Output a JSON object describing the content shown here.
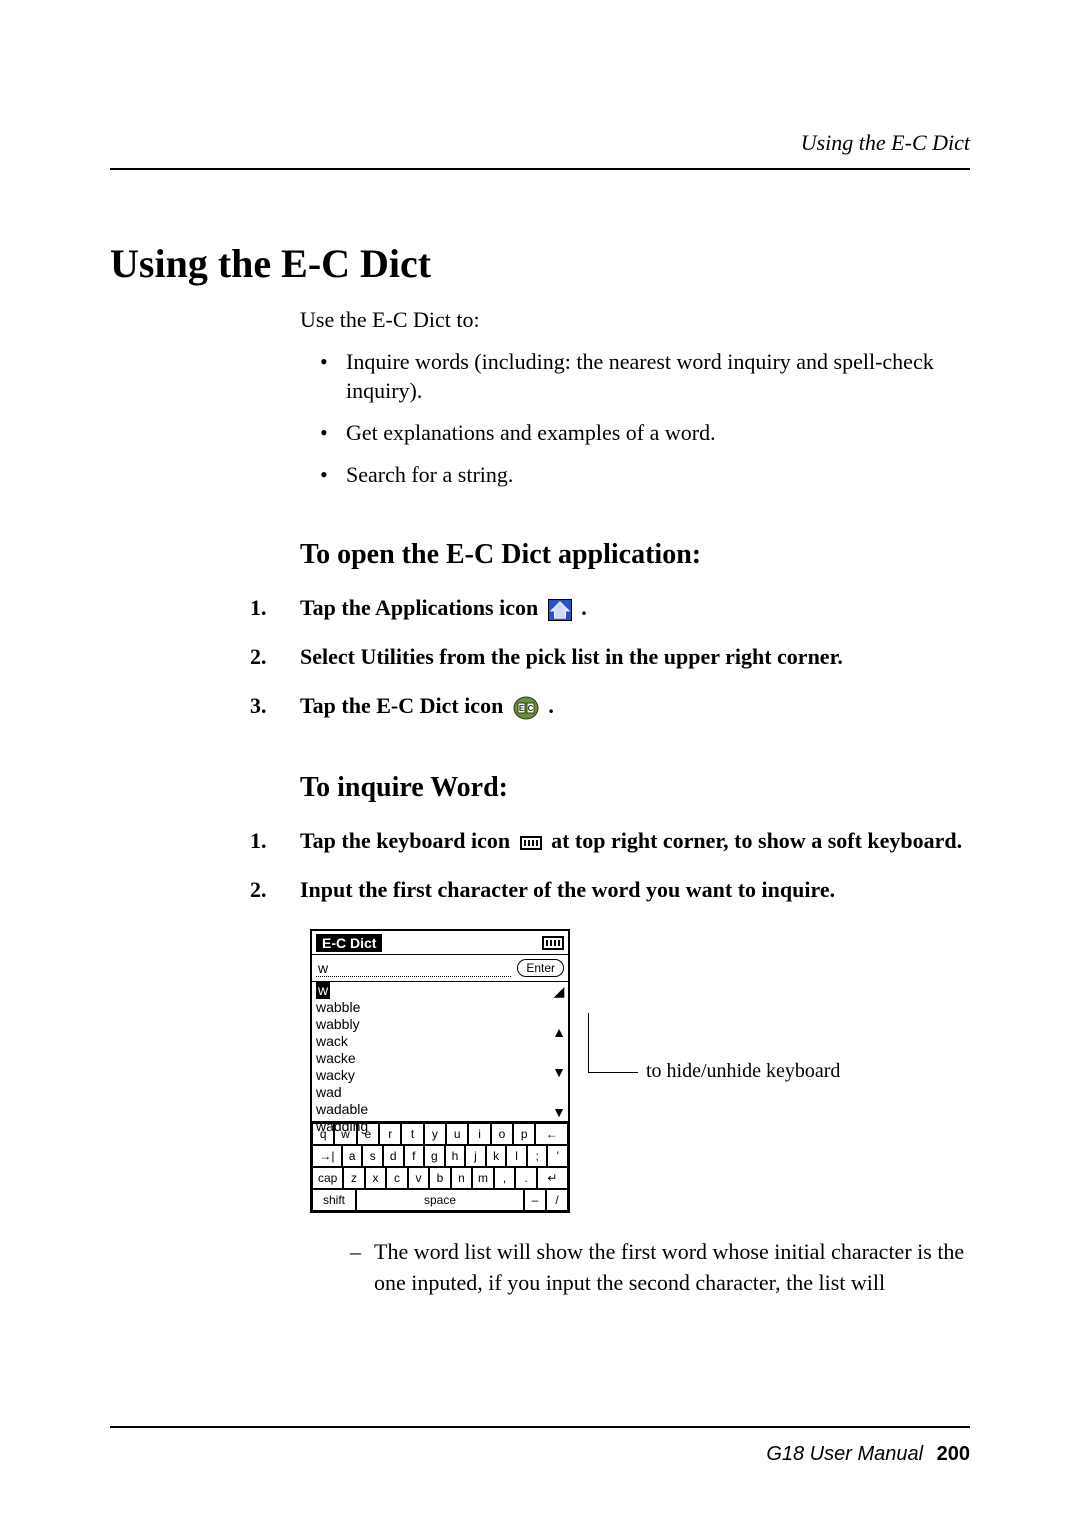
{
  "running_head": "Using the E-C Dict",
  "h1": "Using the E-C Dict",
  "intro": "Use the E-C Dict to:",
  "bullets": [
    "Inquire words (including: the nearest word inquiry and spell-check inquiry).",
    "Get explanations and examples of a word.",
    "Search for a string."
  ],
  "h2_open": "To open the E-C Dict application:",
  "open_steps": {
    "s1_a": "Tap the Applications icon ",
    "s1_b": " .",
    "s2": "Select Utilities from the pick list in the upper right corner.",
    "s3_a": "Tap the E-C Dict icon ",
    "s3_b": " ."
  },
  "h2_inquire": "To inquire Word:",
  "inquire_steps": {
    "s1_a": "Tap the keyboard icon ",
    "s1_b": " at top right corner, to show a soft keyboard.",
    "s2": "Input the first character of the word you want to inquire."
  },
  "screenshot": {
    "title": "E-C Dict",
    "input_value": "w",
    "enter_label": "Enter",
    "list": [
      "w",
      "wabble",
      "wabbly",
      "wack",
      "wacke",
      "wacky",
      "wad",
      "wadable",
      "wadding"
    ],
    "osk_rows": [
      [
        "q",
        "w",
        "e",
        "r",
        "t",
        "y",
        "u",
        "i",
        "o",
        "p",
        "←"
      ],
      [
        "→|",
        "a",
        "s",
        "d",
        "f",
        "g",
        "h",
        "j",
        "k",
        "l",
        ";",
        "'"
      ],
      [
        "cap",
        "z",
        "x",
        "c",
        "v",
        "b",
        "n",
        "m",
        ",",
        ".",
        "↵"
      ]
    ],
    "space_row": {
      "shift": "shift",
      "space": "space",
      "dash": "–",
      "slash": "/"
    },
    "callout": "to hide/unhide keyboard"
  },
  "subnote": "The word list will show the first word whose initial character is the one inputed, if you input the second character, the list will",
  "footer_label": "G18 User Manual",
  "page_number": "200"
}
